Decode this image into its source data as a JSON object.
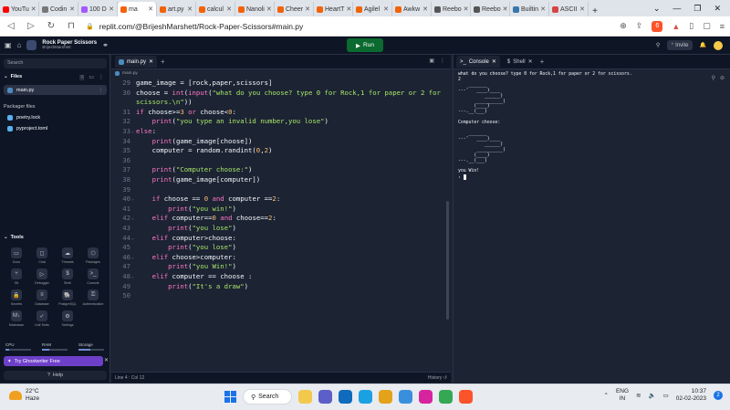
{
  "browser": {
    "tabs": [
      {
        "label": "YouTu",
        "color": "#ff0000",
        "active": false
      },
      {
        "label": "Codin",
        "color": "#777777",
        "active": false
      },
      {
        "label": "100 D",
        "color": "#a259ff",
        "active": false
      },
      {
        "label": "ma",
        "color": "#f26207",
        "active": true
      },
      {
        "label": "art.py",
        "color": "#f26207",
        "active": false
      },
      {
        "label": "calcul",
        "color": "#f26207",
        "active": false
      },
      {
        "label": "Nanoli",
        "color": "#f26207",
        "active": false
      },
      {
        "label": "Cheer",
        "color": "#f26207",
        "active": false
      },
      {
        "label": "HeartT",
        "color": "#f26207",
        "active": false
      },
      {
        "label": "Agilel",
        "color": "#f26207",
        "active": false
      },
      {
        "label": "Awkw",
        "color": "#f26207",
        "active": false
      },
      {
        "label": "Reebo",
        "color": "#555555",
        "active": false
      },
      {
        "label": "Reebo",
        "color": "#555555",
        "active": false
      },
      {
        "label": "Builtin",
        "color": "#3776ab",
        "active": false
      },
      {
        "label": "ASCII",
        "color": "#d64545",
        "active": false
      }
    ],
    "url": "replit.com/@BrijeshMarshett/Rock-Paper-Scissors#main.py",
    "brave_count": "6"
  },
  "header": {
    "repl_name": "Rock Paper Scissors",
    "repl_owner": "BrijeshMarshett",
    "run_label": "Run",
    "invite_label": "Invite"
  },
  "sidebar": {
    "search_placeholder": "Search",
    "files_title": "Files",
    "files": [
      {
        "name": "main.py",
        "active": true
      }
    ],
    "packager_title": "Packager files",
    "packager_files": [
      "poetry.lock",
      "pyproject.toml"
    ],
    "tools_title": "Tools",
    "tools": [
      {
        "label": "Docs",
        "icon": "▭"
      },
      {
        "label": "Chat",
        "icon": "◻"
      },
      {
        "label": "Threads",
        "icon": "☁"
      },
      {
        "label": "Packages",
        "icon": "⬡"
      },
      {
        "label": "Git",
        "icon": "⑂"
      },
      {
        "label": "Debugger",
        "icon": "▷"
      },
      {
        "label": "Shell",
        "icon": "$"
      },
      {
        "label": "Console",
        "icon": ">_"
      },
      {
        "label": "Secrets",
        "icon": "🔒"
      },
      {
        "label": "Database",
        "icon": "≡"
      },
      {
        "label": "PostgreSQL",
        "icon": "🐘"
      },
      {
        "label": "Authentication",
        "icon": "⚿"
      },
      {
        "label": "Markdown",
        "icon": "M↓"
      },
      {
        "label": "Unit Tests",
        "icon": "✓"
      },
      {
        "label": "Settings",
        "icon": "⚙"
      }
    ],
    "meters": [
      {
        "label": "CPU",
        "value": 0.15
      },
      {
        "label": "RAM",
        "value": 0.3
      },
      {
        "label": "Storage",
        "value": 0.45
      }
    ],
    "ghostwriter_label": "Try Ghostwriter Free",
    "help_label": "Help"
  },
  "editor": {
    "tab_label": "main.py",
    "crumb": "main.py",
    "status_position": "Line 4 : Col 12",
    "status_history": "History",
    "lines": [
      {
        "n": "29",
        "fold": "",
        "html": "game_image = [rock,paper,scissors]"
      },
      {
        "n": "30",
        "fold": "",
        "html": "choose = <span class=\"kw\">int</span>(<span class=\"kw\">input</span>(<span class=\"str\">\"what do you choose? type 0 for Rock,1 for paper or 2 for</span>"
      },
      {
        "n": "",
        "fold": "",
        "html": "<span class=\"str\">scissors.\\n\"</span>))"
      },
      {
        "n": "31",
        "fold": "",
        "html": "<span class=\"kw\">if</span> choose&gt;=<span class=\"num\">3</span> <span class=\"kw\">or</span> choose&lt;<span class=\"num\">0</span>:"
      },
      {
        "n": "32",
        "fold": "",
        "html": "    <span class=\"kw\">print</span>(<span class=\"str\">\"you type an invalid number,you lose\"</span>)"
      },
      {
        "n": "33",
        "fold": "⌄",
        "html": "<span class=\"kw\">else</span>:"
      },
      {
        "n": "34",
        "fold": "",
        "html": "    <span class=\"kw\">print</span>(game_image[choose])"
      },
      {
        "n": "35",
        "fold": "",
        "html": "    computer = random.randint(<span class=\"num\">0</span>,<span class=\"num\">2</span>)"
      },
      {
        "n": "36",
        "fold": "",
        "html": ""
      },
      {
        "n": "37",
        "fold": "",
        "html": "    <span class=\"kw\">print</span>(<span class=\"str\">\"Computer choose:\"</span>)"
      },
      {
        "n": "38",
        "fold": "",
        "html": "    <span class=\"kw\">print</span>(game_image[computer])"
      },
      {
        "n": "39",
        "fold": "",
        "html": ""
      },
      {
        "n": "40",
        "fold": "⌄",
        "html": "    <span class=\"kw\">if</span> choose == <span class=\"num\">0</span> <span class=\"kw\">and</span> computer ==<span class=\"num\">2</span>:"
      },
      {
        "n": "41",
        "fold": "",
        "html": "        <span class=\"kw\">print</span>(<span class=\"str\">\"you win!\"</span>)"
      },
      {
        "n": "42",
        "fold": "⌄",
        "html": "    <span class=\"kw\">elif</span> computer==<span class=\"num\">0</span> <span class=\"kw\">and</span> choose==<span class=\"num\">2</span>:"
      },
      {
        "n": "43",
        "fold": "",
        "html": "        <span class=\"kw\">print</span>(<span class=\"str\">\"you lose\"</span>)"
      },
      {
        "n": "44",
        "fold": "⌄",
        "html": "    <span class=\"kw\">elif</span> computer&gt;choose:"
      },
      {
        "n": "45",
        "fold": "",
        "html": "        <span class=\"kw\">print</span>(<span class=\"str\">\"you lose\"</span>)"
      },
      {
        "n": "46",
        "fold": "⌄",
        "html": "    <span class=\"kw\">elif</span> choose&gt;computer:"
      },
      {
        "n": "47",
        "fold": "",
        "html": "        <span class=\"kw\">print</span>(<span class=\"str\">\"you Win!\"</span>)"
      },
      {
        "n": "48",
        "fold": "⌄",
        "html": "    <span class=\"kw\">elif</span> computer == choose :"
      },
      {
        "n": "49",
        "fold": "",
        "html": "        <span class=\"kw\">print</span>(<span class=\"str\">\"It's a draw\"</span>)"
      },
      {
        "n": "50",
        "fold": "",
        "html": ""
      }
    ]
  },
  "console": {
    "tabs": [
      {
        "label": "Console",
        "active": true
      },
      {
        "label": "Shell",
        "active": false
      }
    ],
    "output": "what do you choose? type 0 for Rock,1 for paper or 2 for scissors.\n2\n    _______\n---'   ____)____\n          ______)\n       __________)\n      (____)\n---.__(___)\n\nComputer choose:\n\n    _______\n---'   ____)____\n          ______)\n       __________)\n      (____)\n---.__(___)\n\nyou Win!\n› "
  },
  "taskbar": {
    "temp": "22°C",
    "condition": "Haze",
    "search_label": "Search",
    "apps": [
      {
        "name": "file-explorer",
        "color": "#f2c94c"
      },
      {
        "name": "meet",
        "color": "#5b5fc7"
      },
      {
        "name": "mail",
        "color": "#0f6cbd"
      },
      {
        "name": "edge",
        "color": "#1ba1e2"
      },
      {
        "name": "files",
        "color": "#e3a21a"
      },
      {
        "name": "store",
        "color": "#3a8fdc"
      },
      {
        "name": "instagram",
        "color": "#d6249f"
      },
      {
        "name": "chrome",
        "color": "#34a853"
      },
      {
        "name": "brave",
        "color": "#fb542b"
      }
    ],
    "lang_1": "ENG",
    "lang_2": "IN",
    "time": "10:37",
    "date": "02-02-2023",
    "notifications": "2"
  }
}
